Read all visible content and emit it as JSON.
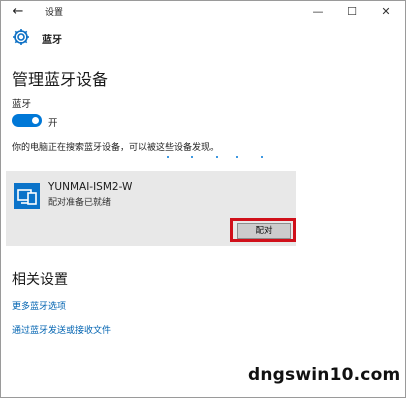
{
  "window": {
    "title": "设置",
    "back_glyph": "←",
    "min_glyph": "—",
    "max_glyph": "☐",
    "close_glyph": "✕"
  },
  "header": {
    "icon": "gear-icon",
    "title": "蓝牙"
  },
  "main": {
    "page_title": "管理蓝牙设备",
    "bluetooth_label": "蓝牙",
    "toggle_state": "开",
    "status_text": "你的电脑正在搜索蓝牙设备，可以被这些设备发现。"
  },
  "device": {
    "icon": "devices-icon",
    "name": "YUNMAI-ISM2-W",
    "status": "配对准备已就绪",
    "pair_label": "配对"
  },
  "related": {
    "title": "相关设置",
    "links": [
      {
        "label": "更多蓝牙选项"
      },
      {
        "label": "通过蓝牙发送或接收文件"
      }
    ]
  },
  "watermark": "dngswin10.com",
  "colors": {
    "accent": "#0078d7",
    "link": "#0063b1",
    "highlight": "#d0101a",
    "panel": "#e8e8e8"
  }
}
